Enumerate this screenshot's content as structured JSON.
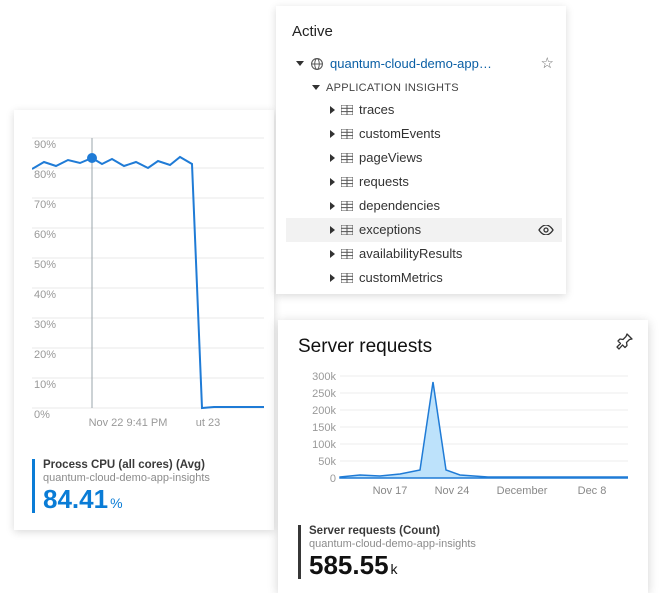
{
  "cpu": {
    "metric_title": "Process CPU (all cores) (Avg)",
    "metric_sub": "quantum-cloud-demo-app-insights",
    "metric_value": "84.41",
    "metric_unit": "%",
    "marker_label": "Nov 22 9:41 PM",
    "x_tick_right": "ut 23"
  },
  "chart_data": [
    {
      "type": "line",
      "name": "cpu-chart",
      "title": "Process CPU (all cores) (Avg)",
      "ylabel": "%",
      "ylim": [
        0,
        100
      ],
      "y_ticks": [
        0,
        10,
        20,
        30,
        40,
        50,
        60,
        70,
        80,
        90
      ],
      "x": [
        0,
        0.05,
        0.1,
        0.15,
        0.2,
        0.22,
        0.3,
        0.35,
        0.4,
        0.45,
        0.5,
        0.55,
        0.6,
        0.65,
        0.7,
        0.75,
        0.8,
        0.85,
        1.0
      ],
      "values": [
        80,
        83,
        81,
        84,
        83,
        84.41,
        82,
        84,
        82,
        83,
        81,
        83,
        82,
        85,
        82,
        0,
        0,
        0,
        0
      ],
      "marker": {
        "x": 0.22,
        "y": 84.41,
        "label": "Nov 22 9:41 PM"
      }
    },
    {
      "type": "area",
      "name": "server-requests-chart",
      "title": "Server requests",
      "ylabel": "Count",
      "ylim": [
        0,
        300000
      ],
      "y_ticks": [
        0,
        50000,
        100000,
        150000,
        200000,
        250000,
        300000
      ],
      "y_tick_labels": [
        "0",
        "50k",
        "100k",
        "150k",
        "200k",
        "250k",
        "300k"
      ],
      "categories": [
        "Nov 17",
        "Nov 24",
        "December",
        "Dec 8"
      ],
      "x": [
        0,
        0.08,
        0.16,
        0.24,
        0.32,
        0.36,
        0.4,
        0.44,
        0.52,
        0.6,
        0.7,
        0.8,
        0.9,
        1.0
      ],
      "values": [
        3000,
        5000,
        4000,
        6000,
        12000,
        275000,
        12000,
        6000,
        3000,
        3000,
        3000,
        3000,
        3000,
        3000
      ]
    }
  ],
  "tree": {
    "title": "Active",
    "app_label": "quantum-cloud-demo-app…",
    "section_label": "APPLICATION INSIGHTS",
    "items": {
      "0": {
        "label": "traces"
      },
      "1": {
        "label": "customEvents"
      },
      "2": {
        "label": "pageViews"
      },
      "3": {
        "label": "requests"
      },
      "4": {
        "label": "dependencies"
      },
      "5": {
        "label": "exceptions"
      },
      "6": {
        "label": "availabilityResults"
      },
      "7": {
        "label": "customMetrics"
      }
    }
  },
  "req": {
    "title": "Server requests",
    "metric_title": "Server requests (Count)",
    "metric_sub": "quantum-cloud-demo-app-insights",
    "metric_value": "585.55",
    "metric_unit": "k"
  }
}
